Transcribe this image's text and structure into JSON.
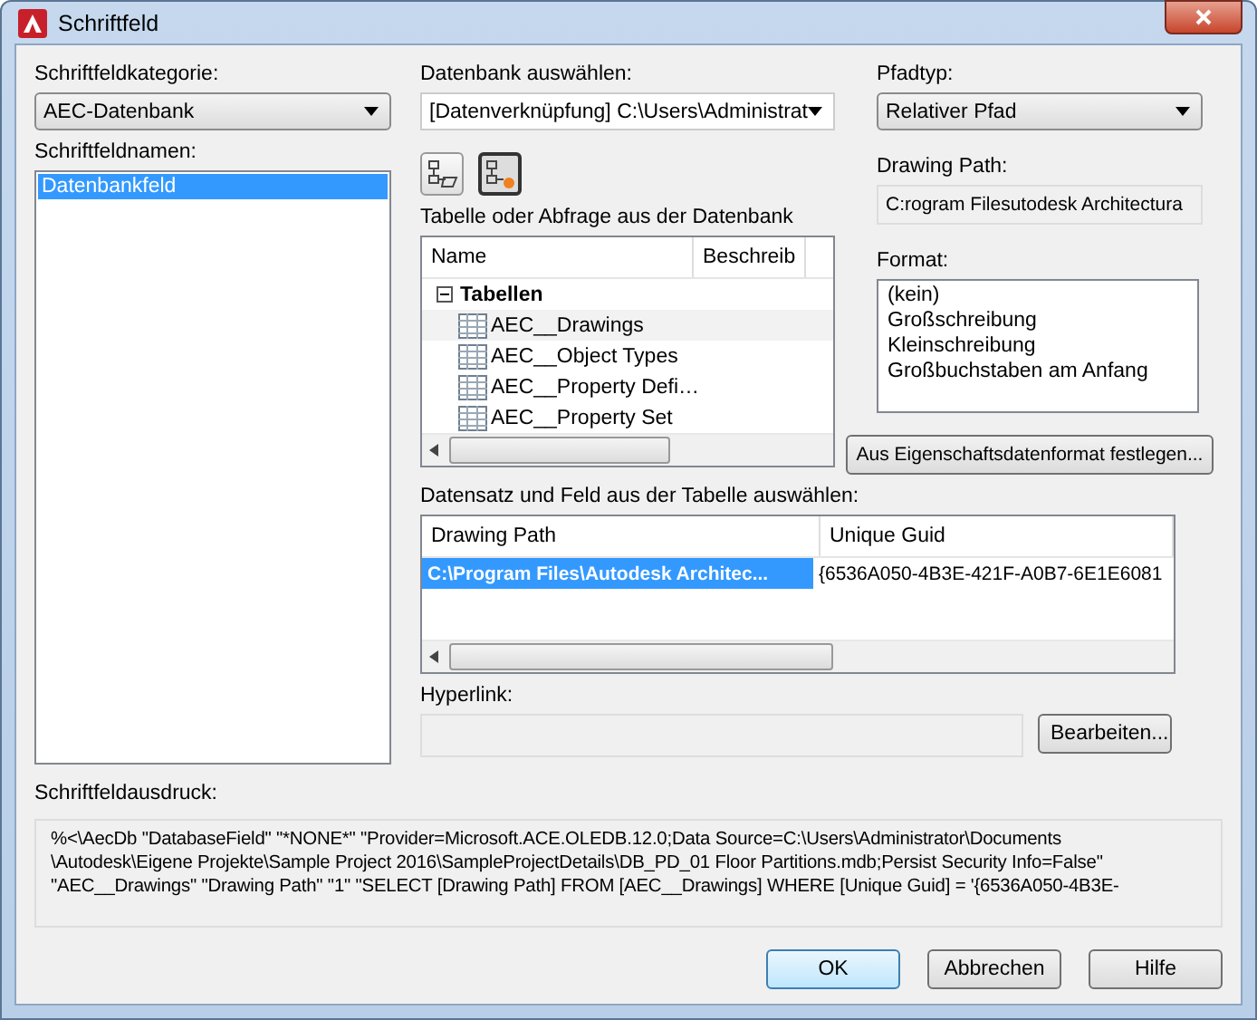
{
  "window": {
    "title": "Schriftfeld"
  },
  "category": {
    "label": "Schriftfeldkategorie:",
    "value": "AEC-Datenbank"
  },
  "field_names": {
    "label": "Schriftfeldnamen:",
    "items": [
      {
        "label": "Datenbankfeld",
        "selected": true
      }
    ]
  },
  "database": {
    "label": "Datenbank auswählen:",
    "value": "[Datenverknüpfung] C:\\Users\\Administrat"
  },
  "toolbar": [
    {
      "kind": "open",
      "pressed": false
    },
    {
      "kind": "new",
      "pressed": true
    }
  ],
  "table_picker": {
    "label": "Tabelle oder Abfrage aus der Datenbank",
    "columns": [
      "Name",
      "Beschreib"
    ],
    "tree": [
      {
        "label": "Tabellen",
        "expanded": true,
        "children": [
          {
            "label": "AEC__Drawings"
          },
          {
            "label": "AEC__Object Types"
          },
          {
            "label": "AEC__Property Defi…"
          },
          {
            "label": "AEC__Property Set"
          }
        ]
      }
    ]
  },
  "path_type": {
    "label": "Pfadtyp:",
    "value": "Relativer Pfad"
  },
  "drawing_path": {
    "label": "Drawing Path:",
    "value": "C:rogram Filesutodesk Architectura"
  },
  "format": {
    "label": "Format:",
    "items": [
      {
        "label": "(kein)",
        "selected": false
      },
      {
        "label": "Großschreibung",
        "selected": false
      },
      {
        "label": "Kleinschreibung",
        "selected": false
      },
      {
        "label": "Großbuchstaben am Anfang",
        "selected": false
      }
    ]
  },
  "format_button": "Aus Eigenschaftsdatenformat festlegen...",
  "records": {
    "label": "Datensatz und Feld aus der Tabelle auswählen:",
    "columns": [
      "Drawing Path",
      "Unique Guid"
    ],
    "rows": [
      {
        "cells": [
          "C:\\Program Files\\Autodesk Architec...",
          "{6536A050-4B3E-421F-A0B7-6E1E6081"
        ],
        "selected": true
      }
    ]
  },
  "hyperlink": {
    "label": "Hyperlink:",
    "button": "Bearbeiten..."
  },
  "expression": {
    "label": "Schriftfeldausdruck:",
    "text": "%<\\AecDb \"DatabaseField\" \"*NONE*\" \"Provider=Microsoft.ACE.OLEDB.12.0;Data Source=C:\\Users\\Administrator\\Documents \\Autodesk\\Eigene Projekte\\Sample Project 2016\\SampleProjectDetails\\DB_PD_01 Floor Partitions.mdb;Persist Security Info=False\" \"AEC__Drawings\" \"Drawing Path\" \"1\" \"SELECT [Drawing Path] FROM [AEC__Drawings] WHERE [Unique Guid] = '{6536A050-4B3E-"
  },
  "buttons": [
    {
      "label": "OK",
      "default": true
    },
    {
      "label": "Abbrechen",
      "default": false
    },
    {
      "label": "Hilfe",
      "default": false
    }
  ]
}
